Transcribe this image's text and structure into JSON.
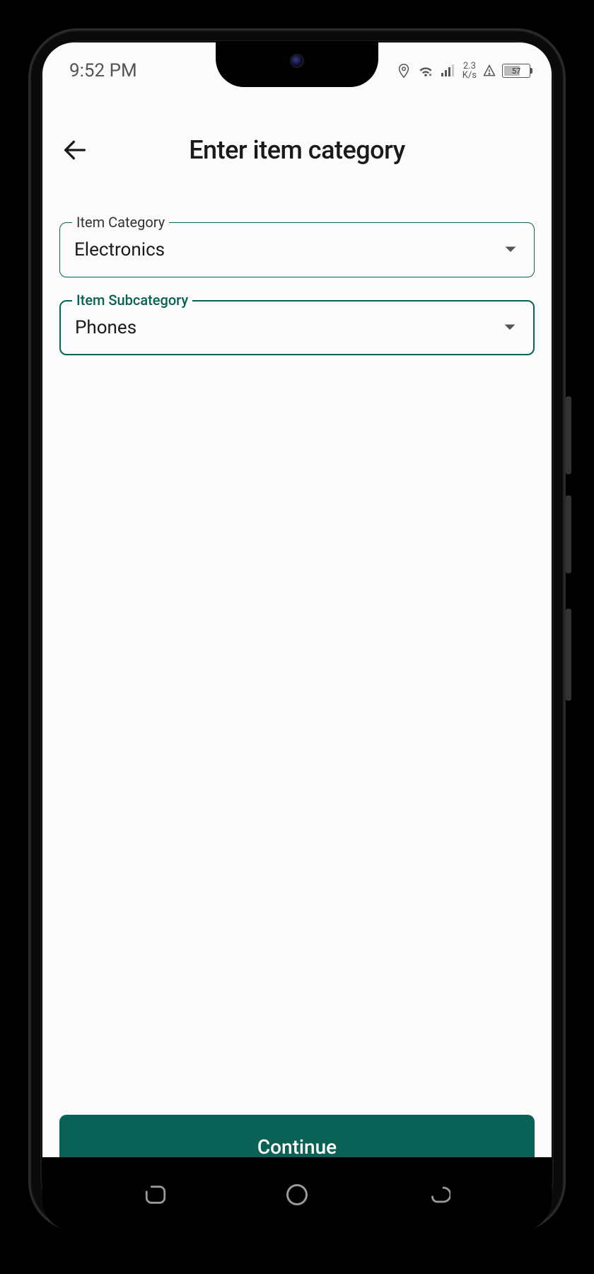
{
  "status": {
    "time": "9:52 PM",
    "data_rate_top": "2.3",
    "data_rate_bottom": "K/s",
    "battery_pct": "57"
  },
  "header": {
    "title": "Enter item category"
  },
  "form": {
    "category": {
      "label": "Item Category",
      "value": "Electronics"
    },
    "subcategory": {
      "label": "Item Subcategory",
      "value": "Phones"
    }
  },
  "actions": {
    "continue_label": "Continue"
  }
}
